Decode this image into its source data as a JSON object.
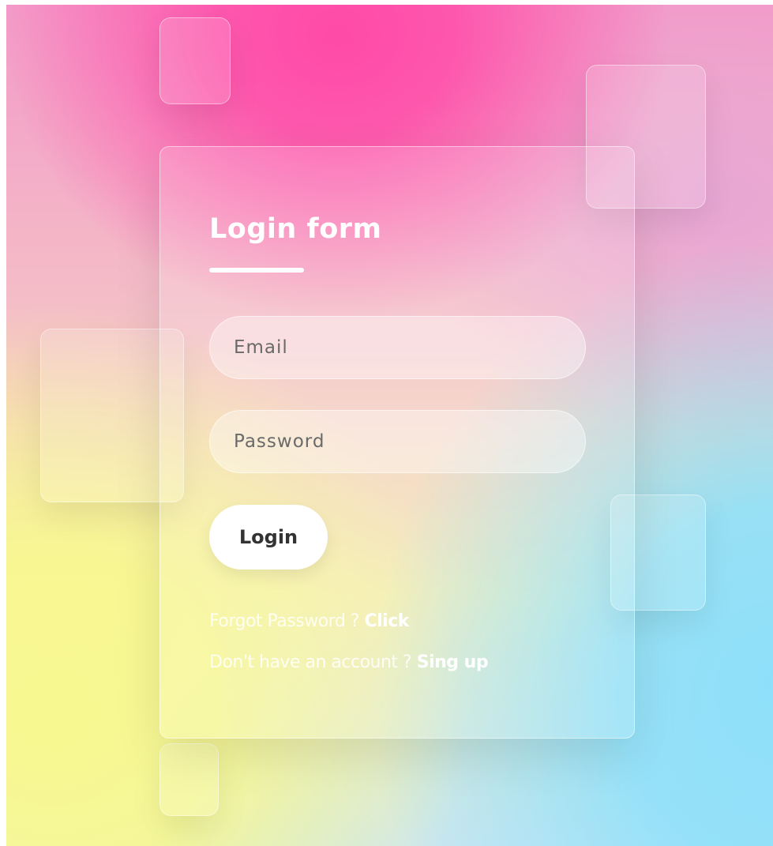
{
  "form": {
    "title": "Login form",
    "email_placeholder": "Email",
    "password_placeholder": "Password",
    "login_label": "Login",
    "forgot_text": "Forgot Password ? ",
    "forgot_link": "Click",
    "signup_text": "Don't have an account ? ",
    "signup_link": "Sing up"
  },
  "colors": {
    "top_gradient": "#ff4aa8",
    "bottom_left_gradient": "#f8f890",
    "bottom_right_gradient": "#8ee0fb",
    "button_background": "#ffffff",
    "text": "#ffffff"
  }
}
